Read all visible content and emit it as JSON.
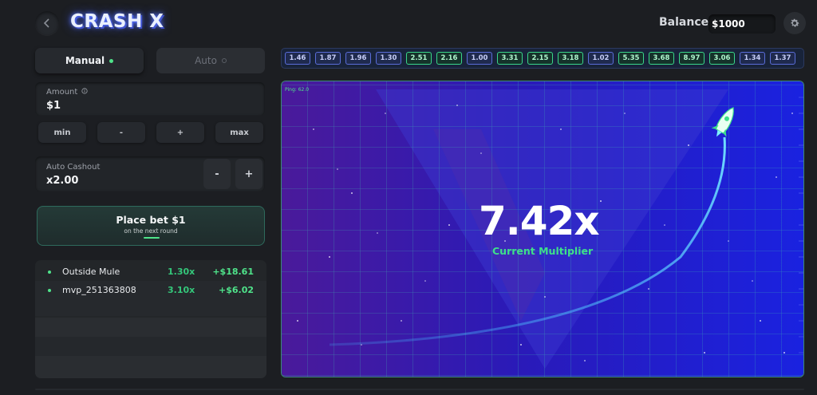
{
  "header": {
    "logo": "CRASH X",
    "balance_label": "Balance:",
    "balance_value": "$1000"
  },
  "tabs": {
    "manual": "Manual",
    "auto": "Auto"
  },
  "amount": {
    "label": "Amount",
    "value": "$1"
  },
  "quick_buttons": [
    "min",
    "-",
    "+",
    "max"
  ],
  "auto_cashout": {
    "label": "Auto Cashout",
    "value": "x2.00",
    "minus": "-",
    "plus": "+"
  },
  "place_bet": {
    "title": "Place bet $1",
    "subtitle": "on the next round"
  },
  "bets": [
    {
      "name": "Outside Mule",
      "multiplier": "1.30x",
      "win": "+$18.61"
    },
    {
      "name": "mvp_251363808",
      "multiplier": "3.10x",
      "win": "+$6.02"
    }
  ],
  "history": [
    {
      "value": "1.46",
      "status": "blue"
    },
    {
      "value": "1.87",
      "status": "blue"
    },
    {
      "value": "1.96",
      "status": "blue"
    },
    {
      "value": "1.30",
      "status": "blue"
    },
    {
      "value": "2.51",
      "status": "green"
    },
    {
      "value": "2.16",
      "status": "green"
    },
    {
      "value": "1.00",
      "status": "blue"
    },
    {
      "value": "3.31",
      "status": "green"
    },
    {
      "value": "2.15",
      "status": "green"
    },
    {
      "value": "3.18",
      "status": "green"
    },
    {
      "value": "1.02",
      "status": "blue"
    },
    {
      "value": "5.35",
      "status": "green"
    },
    {
      "value": "3.68",
      "status": "green"
    },
    {
      "value": "8.97",
      "status": "green"
    },
    {
      "value": "3.06",
      "status": "green"
    },
    {
      "value": "1.34",
      "status": "blue"
    },
    {
      "value": "1.37",
      "status": "blue"
    }
  ],
  "game": {
    "ping": "Ping: 62.0",
    "multiplier": "7.42x",
    "multiplier_label": "Current Multiplier"
  },
  "colors": {
    "accent_green": "#4fe38a",
    "background": "#1c1e22",
    "game_purple": "#3b1a8c",
    "game_blue": "#1a1ad6"
  },
  "icons": {
    "back": "chevron-left-icon",
    "settings": "gear-icon",
    "amount_info": "info-icon",
    "rocket": "rocket-icon"
  }
}
